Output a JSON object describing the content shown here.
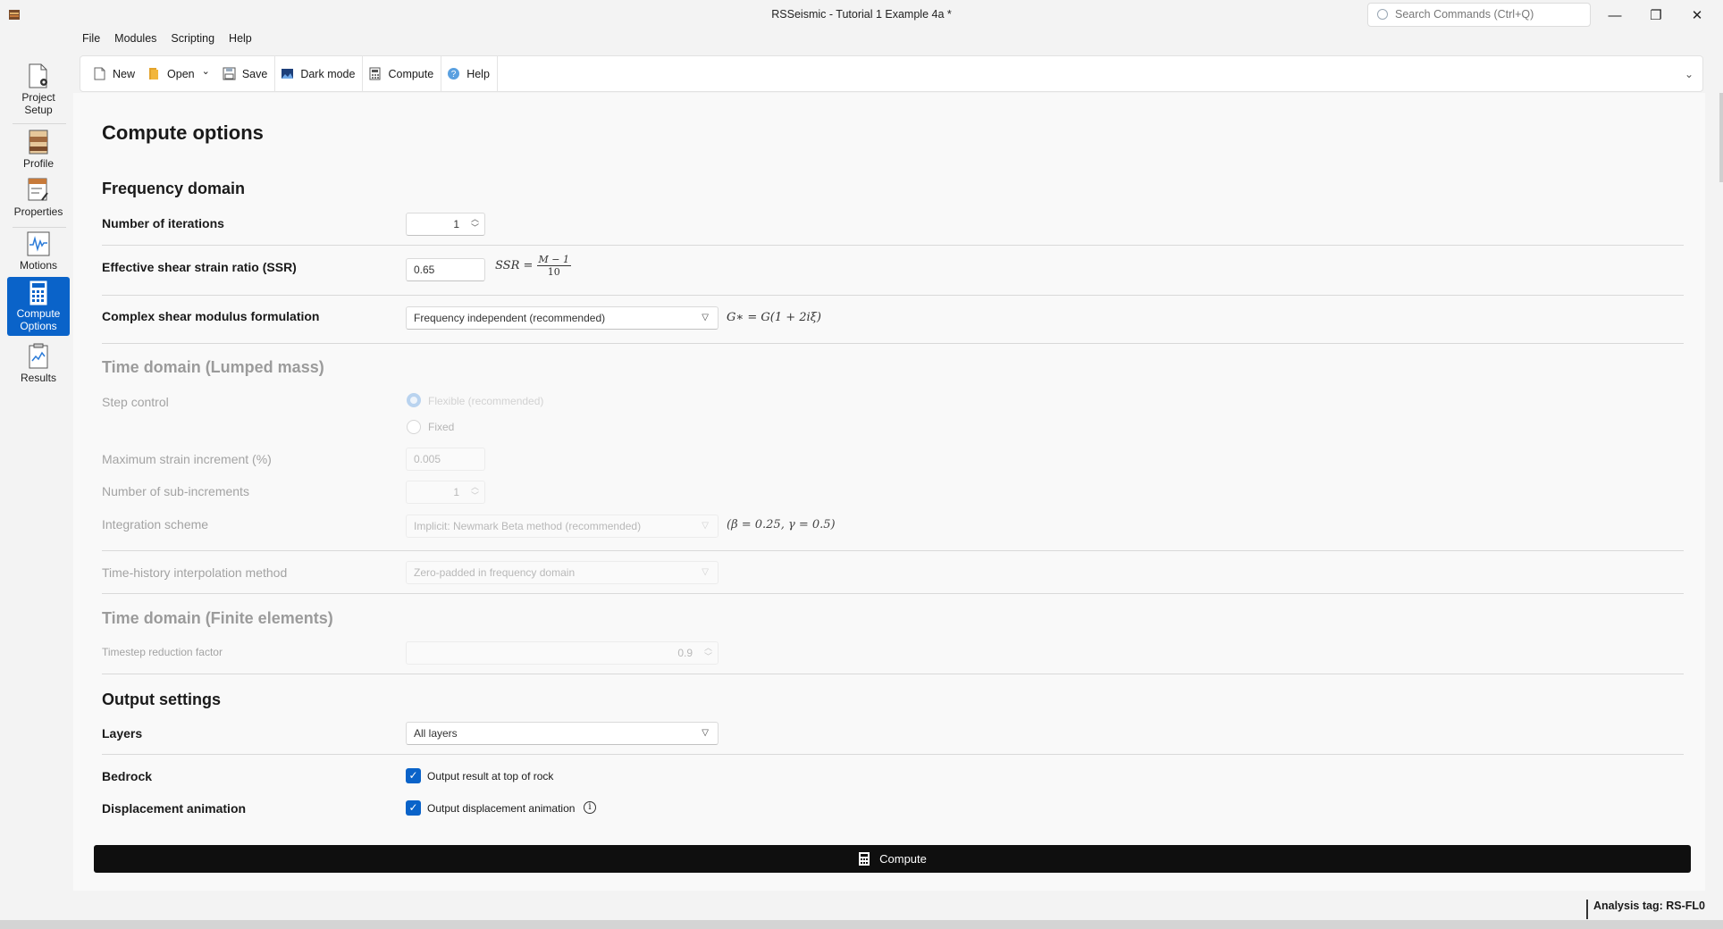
{
  "window": {
    "title": "RSSeismic - Tutorial 1 Example 4a *",
    "search_placeholder": "Search Commands (Ctrl+Q)",
    "minimize_glyph": "—",
    "maximize_glyph": "❐",
    "close_glyph": "✕"
  },
  "rail": {
    "items": [
      {
        "label_line1": "Project",
        "label_line2": "Setup",
        "icon": "project-setup-icon"
      },
      {
        "label_line1": "Profile",
        "label_line2": "",
        "icon": "profile-icon"
      },
      {
        "label_line1": "Properties",
        "label_line2": "",
        "icon": "properties-icon"
      },
      {
        "label_line1": "Motions",
        "label_line2": "",
        "icon": "motions-icon"
      },
      {
        "label_line1": "Compute",
        "label_line2": "Options",
        "icon": "compute-options-icon",
        "active": true
      },
      {
        "label_line1": "Results",
        "label_line2": "",
        "icon": "results-icon"
      }
    ]
  },
  "menu": {
    "file": "File",
    "modules": "Modules",
    "scripting": "Scripting",
    "help": "Help"
  },
  "toolbar": {
    "new": "New",
    "open": "Open",
    "open_caret": "⌄",
    "save": "Save",
    "dark_mode": "Dark mode",
    "compute": "Compute",
    "help": "Help",
    "expand_caret": "⌄"
  },
  "page": {
    "title": "Compute options",
    "frequency": {
      "heading": "Frequency domain",
      "iterations_label": "Number of iterations",
      "iterations_value": "1",
      "ssr_label": "Effective shear strain ratio (SSR)",
      "ssr_value": "0.65",
      "ssr_formula_lhs": "SSR =",
      "ssr_formula_num": "M − 1",
      "ssr_formula_den": "10",
      "modulus_label": "Complex shear modulus formulation",
      "modulus_value": "Frequency independent (recommended)",
      "modulus_formula": "G∗ = G(1 + 2iξ)"
    },
    "lumped": {
      "heading": "Time domain (Lumped mass)",
      "step_control_label": "Step control",
      "step_option_flexible": "Flexible (recommended)",
      "step_option_fixed": "Fixed",
      "max_strain_label": "Maximum strain increment (%)",
      "max_strain_value": "0.005",
      "sub_increments_label": "Number of sub-increments",
      "sub_increments_value": "1",
      "integration_label": "Integration scheme",
      "integration_value": "Implicit: Newmark Beta method (recommended)",
      "integration_formula": "(β = 0.25, γ = 0.5)",
      "interp_label": "Time-history interpolation method",
      "interp_value": "Zero-padded in frequency domain"
    },
    "finite": {
      "heading": "Time domain (Finite elements)",
      "timestep_label": "Timestep reduction factor",
      "timestep_value": "0.9"
    },
    "output": {
      "heading": "Output settings",
      "layers_label": "Layers",
      "layers_value": "All layers",
      "bedrock_label": "Bedrock",
      "bedrock_option": "Output result at top of rock",
      "bedrock_checked": true,
      "displacement_label": "Displacement animation",
      "displacement_option": "Output displacement animation",
      "displacement_checked": true,
      "info_glyph": "i"
    },
    "compute_button": "Compute"
  },
  "status": {
    "analysis_tag": "Analysis tag: RS-FL0"
  },
  "colors": {
    "accent": "#0a63c9",
    "compute_bar": "#0f0f0f"
  }
}
